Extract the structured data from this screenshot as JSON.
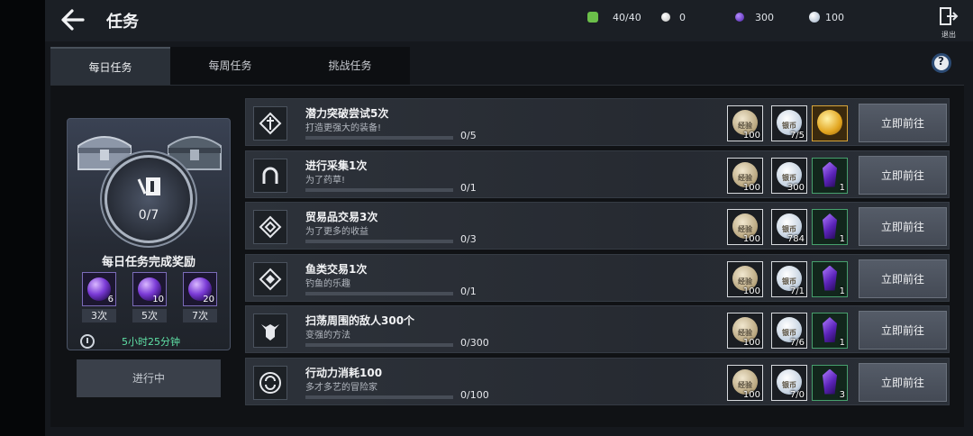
{
  "header": {
    "title": "任务",
    "resources": [
      {
        "icon": "stamina-icon",
        "value": "40/40",
        "color": "#6bbf4a"
      },
      {
        "icon": "pearl-icon",
        "value": "0",
        "color": "#e8e8e8"
      },
      {
        "icon": "purple-gem-icon",
        "value": "300",
        "color": "#7f4de0"
      },
      {
        "icon": "silver-coin-icon",
        "value": "100",
        "color": "#cfd8e3"
      }
    ],
    "exit_label": "退出"
  },
  "tabs": [
    {
      "label": "每日任务",
      "active": true
    },
    {
      "label": "每周任务",
      "active": false
    },
    {
      "label": "挑战任务",
      "active": false
    }
  ],
  "reward_card": {
    "count": "0/7",
    "title": "每日任务完成奖励",
    "orbs": [
      {
        "amount": "6",
        "label": "3次"
      },
      {
        "amount": "10",
        "label": "5次"
      },
      {
        "amount": "20",
        "label": "7次"
      }
    ],
    "timer": "5小时25分钟",
    "status_button": "进行中"
  },
  "tasks": [
    {
      "icon": "sword-icon",
      "name": "潜力突破尝试5次",
      "desc": "打造更强大的装备!",
      "progress": "0/5",
      "rewards": [
        {
          "type": "exp",
          "text": "经验",
          "count": "100"
        },
        {
          "type": "silver",
          "text": "银币",
          "count": "7/5"
        },
        {
          "type": "gold",
          "text": "",
          "count": ""
        }
      ],
      "button": "立即前往"
    },
    {
      "icon": "horseshoe-icon",
      "name": "进行采集1次",
      "desc": "为了药草!",
      "progress": "0/1",
      "rewards": [
        {
          "type": "exp",
          "text": "经验",
          "count": "100"
        },
        {
          "type": "silver",
          "text": "银币",
          "count": "300"
        },
        {
          "type": "crystal",
          "text": "",
          "count": "1"
        }
      ],
      "button": "立即前往"
    },
    {
      "icon": "trade-icon",
      "name": "贸易品交易3次",
      "desc": "为了更多的收益",
      "progress": "0/3",
      "rewards": [
        {
          "type": "exp",
          "text": "经验",
          "count": "100"
        },
        {
          "type": "silver",
          "text": "银币",
          "count": "784"
        },
        {
          "type": "crystal",
          "text": "",
          "count": "1"
        }
      ],
      "button": "立即前往"
    },
    {
      "icon": "fish-trade-icon",
      "name": "鱼类交易1次",
      "desc": "钓鱼的乐趣",
      "progress": "0/1",
      "rewards": [
        {
          "type": "exp",
          "text": "经验",
          "count": "100"
        },
        {
          "type": "silver",
          "text": "银币",
          "count": "7/1"
        },
        {
          "type": "crystal",
          "text": "",
          "count": "1"
        }
      ],
      "button": "立即前往"
    },
    {
      "icon": "helmet-icon",
      "name": "扫荡周围的敌人300个",
      "desc": "变强的方法",
      "progress": "0/300",
      "rewards": [
        {
          "type": "exp",
          "text": "经验",
          "count": "100"
        },
        {
          "type": "silver",
          "text": "银币",
          "count": "7/6"
        },
        {
          "type": "crystal",
          "text": "",
          "count": "1"
        }
      ],
      "button": "立即前往"
    },
    {
      "icon": "refresh-icon",
      "name": "行动力消耗100",
      "desc": "多才多艺的冒险家",
      "progress": "0/100",
      "rewards": [
        {
          "type": "exp",
          "text": "经验",
          "count": "100"
        },
        {
          "type": "silver",
          "text": "银币",
          "count": "7/0"
        },
        {
          "type": "crystal",
          "text": "",
          "count": "3"
        }
      ],
      "button": "立即前往"
    }
  ]
}
